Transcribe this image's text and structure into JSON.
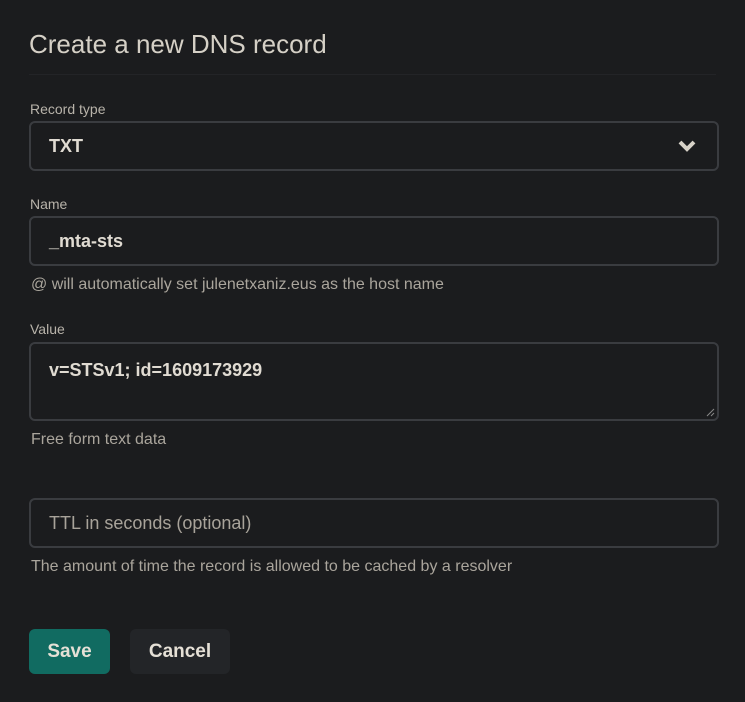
{
  "title": "Create a new DNS record",
  "record_type": {
    "label": "Record type",
    "value": "TXT"
  },
  "name": {
    "label": "Name",
    "value": "_mta-sts",
    "help": "@ will automatically set julenetxaniz.eus as the host name"
  },
  "value": {
    "label": "Value",
    "value": "v=STSv1; id=1609173929",
    "help": "Free form text data"
  },
  "ttl": {
    "placeholder": "TTL in seconds (optional)",
    "help": "The amount of time the record is allowed to be cached by a resolver"
  },
  "buttons": {
    "save": "Save",
    "cancel": "Cancel"
  },
  "colors": {
    "accent": "#116b61",
    "secondary": "#232528"
  }
}
